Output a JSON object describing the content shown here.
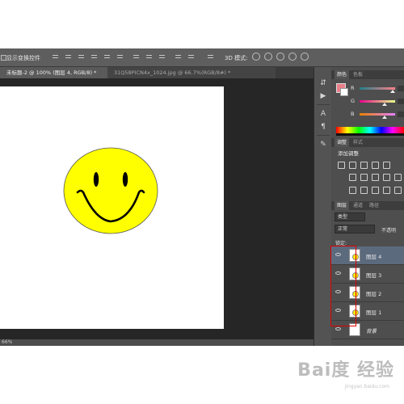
{
  "options_bar": {
    "show_transform_controls": "显示变换控件",
    "mode_3d": "3D 模式:"
  },
  "document_tabs": [
    {
      "label": "未标题-2 @ 100% (图层 4, RGB/8) *",
      "active": true
    },
    {
      "label": "31Q58PICN4x_1024.jpg @ 66.7%(RGB/8#) *",
      "active": false
    }
  ],
  "status_bar": {
    "zoom": "66%"
  },
  "color_panel": {
    "tabs": [
      "颜色",
      "色板"
    ],
    "channels": [
      "R",
      "G",
      "B"
    ],
    "foreground_color": "#e8808a"
  },
  "adjustments_panel": {
    "tabs": [
      "调整",
      "样式"
    ],
    "title": "添加调整"
  },
  "layers_panel": {
    "tabs": [
      "图层",
      "通道",
      "路径"
    ],
    "filter_kind": "类型",
    "blend_mode": "正常",
    "opacity_label": "不透明",
    "lock_label": "锁定:",
    "layers": [
      {
        "name": "图层 4",
        "selected": true
      },
      {
        "name": "图层 3",
        "selected": false
      },
      {
        "name": "图层 2",
        "selected": false
      },
      {
        "name": "图层 1",
        "selected": false
      },
      {
        "name": "背景",
        "selected": false
      }
    ]
  },
  "canvas": {
    "smiley_color": "#ffff00",
    "background": "#ffffff"
  },
  "watermark": {
    "text": "Bai度 经验",
    "sub": "jingyan.baidu.com"
  }
}
